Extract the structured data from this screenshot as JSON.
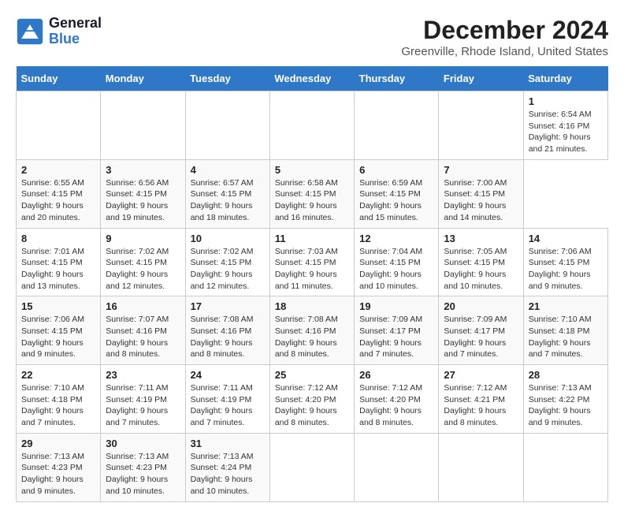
{
  "header": {
    "logo_text_general": "General",
    "logo_text_blue": "Blue",
    "main_title": "December 2024",
    "subtitle": "Greenville, Rhode Island, United States"
  },
  "calendar": {
    "days_of_week": [
      "Sunday",
      "Monday",
      "Tuesday",
      "Wednesday",
      "Thursday",
      "Friday",
      "Saturday"
    ],
    "weeks": [
      [
        null,
        null,
        null,
        null,
        null,
        null,
        {
          "day": "1",
          "sunrise": "Sunrise: 6:54 AM",
          "sunset": "Sunset: 4:16 PM",
          "daylight": "Daylight: 9 hours and 21 minutes."
        }
      ],
      [
        {
          "day": "2",
          "sunrise": "Sunrise: 6:55 AM",
          "sunset": "Sunset: 4:15 PM",
          "daylight": "Daylight: 9 hours and 20 minutes."
        },
        {
          "day": "3",
          "sunrise": "Sunrise: 6:56 AM",
          "sunset": "Sunset: 4:15 PM",
          "daylight": "Daylight: 9 hours and 19 minutes."
        },
        {
          "day": "4",
          "sunrise": "Sunrise: 6:57 AM",
          "sunset": "Sunset: 4:15 PM",
          "daylight": "Daylight: 9 hours and 18 minutes."
        },
        {
          "day": "5",
          "sunrise": "Sunrise: 6:58 AM",
          "sunset": "Sunset: 4:15 PM",
          "daylight": "Daylight: 9 hours and 16 minutes."
        },
        {
          "day": "6",
          "sunrise": "Sunrise: 6:59 AM",
          "sunset": "Sunset: 4:15 PM",
          "daylight": "Daylight: 9 hours and 15 minutes."
        },
        {
          "day": "7",
          "sunrise": "Sunrise: 7:00 AM",
          "sunset": "Sunset: 4:15 PM",
          "daylight": "Daylight: 9 hours and 14 minutes."
        }
      ],
      [
        {
          "day": "8",
          "sunrise": "Sunrise: 7:01 AM",
          "sunset": "Sunset: 4:15 PM",
          "daylight": "Daylight: 9 hours and 13 minutes."
        },
        {
          "day": "9",
          "sunrise": "Sunrise: 7:02 AM",
          "sunset": "Sunset: 4:15 PM",
          "daylight": "Daylight: 9 hours and 12 minutes."
        },
        {
          "day": "10",
          "sunrise": "Sunrise: 7:02 AM",
          "sunset": "Sunset: 4:15 PM",
          "daylight": "Daylight: 9 hours and 12 minutes."
        },
        {
          "day": "11",
          "sunrise": "Sunrise: 7:03 AM",
          "sunset": "Sunset: 4:15 PM",
          "daylight": "Daylight: 9 hours and 11 minutes."
        },
        {
          "day": "12",
          "sunrise": "Sunrise: 7:04 AM",
          "sunset": "Sunset: 4:15 PM",
          "daylight": "Daylight: 9 hours and 10 minutes."
        },
        {
          "day": "13",
          "sunrise": "Sunrise: 7:05 AM",
          "sunset": "Sunset: 4:15 PM",
          "daylight": "Daylight: 9 hours and 10 minutes."
        },
        {
          "day": "14",
          "sunrise": "Sunrise: 7:06 AM",
          "sunset": "Sunset: 4:15 PM",
          "daylight": "Daylight: 9 hours and 9 minutes."
        }
      ],
      [
        {
          "day": "15",
          "sunrise": "Sunrise: 7:06 AM",
          "sunset": "Sunset: 4:15 PM",
          "daylight": "Daylight: 9 hours and 9 minutes."
        },
        {
          "day": "16",
          "sunrise": "Sunrise: 7:07 AM",
          "sunset": "Sunset: 4:16 PM",
          "daylight": "Daylight: 9 hours and 8 minutes."
        },
        {
          "day": "17",
          "sunrise": "Sunrise: 7:08 AM",
          "sunset": "Sunset: 4:16 PM",
          "daylight": "Daylight: 9 hours and 8 minutes."
        },
        {
          "day": "18",
          "sunrise": "Sunrise: 7:08 AM",
          "sunset": "Sunset: 4:16 PM",
          "daylight": "Daylight: 9 hours and 8 minutes."
        },
        {
          "day": "19",
          "sunrise": "Sunrise: 7:09 AM",
          "sunset": "Sunset: 4:17 PM",
          "daylight": "Daylight: 9 hours and 7 minutes."
        },
        {
          "day": "20",
          "sunrise": "Sunrise: 7:09 AM",
          "sunset": "Sunset: 4:17 PM",
          "daylight": "Daylight: 9 hours and 7 minutes."
        },
        {
          "day": "21",
          "sunrise": "Sunrise: 7:10 AM",
          "sunset": "Sunset: 4:18 PM",
          "daylight": "Daylight: 9 hours and 7 minutes."
        }
      ],
      [
        {
          "day": "22",
          "sunrise": "Sunrise: 7:10 AM",
          "sunset": "Sunset: 4:18 PM",
          "daylight": "Daylight: 9 hours and 7 minutes."
        },
        {
          "day": "23",
          "sunrise": "Sunrise: 7:11 AM",
          "sunset": "Sunset: 4:19 PM",
          "daylight": "Daylight: 9 hours and 7 minutes."
        },
        {
          "day": "24",
          "sunrise": "Sunrise: 7:11 AM",
          "sunset": "Sunset: 4:19 PM",
          "daylight": "Daylight: 9 hours and 7 minutes."
        },
        {
          "day": "25",
          "sunrise": "Sunrise: 7:12 AM",
          "sunset": "Sunset: 4:20 PM",
          "daylight": "Daylight: 9 hours and 8 minutes."
        },
        {
          "day": "26",
          "sunrise": "Sunrise: 7:12 AM",
          "sunset": "Sunset: 4:20 PM",
          "daylight": "Daylight: 9 hours and 8 minutes."
        },
        {
          "day": "27",
          "sunrise": "Sunrise: 7:12 AM",
          "sunset": "Sunset: 4:21 PM",
          "daylight": "Daylight: 9 hours and 8 minutes."
        },
        {
          "day": "28",
          "sunrise": "Sunrise: 7:13 AM",
          "sunset": "Sunset: 4:22 PM",
          "daylight": "Daylight: 9 hours and 9 minutes."
        }
      ],
      [
        {
          "day": "29",
          "sunrise": "Sunrise: 7:13 AM",
          "sunset": "Sunset: 4:23 PM",
          "daylight": "Daylight: 9 hours and 9 minutes."
        },
        {
          "day": "30",
          "sunrise": "Sunrise: 7:13 AM",
          "sunset": "Sunset: 4:23 PM",
          "daylight": "Daylight: 9 hours and 10 minutes."
        },
        {
          "day": "31",
          "sunrise": "Sunrise: 7:13 AM",
          "sunset": "Sunset: 4:24 PM",
          "daylight": "Daylight: 9 hours and 10 minutes."
        },
        null,
        null,
        null,
        null
      ]
    ]
  }
}
